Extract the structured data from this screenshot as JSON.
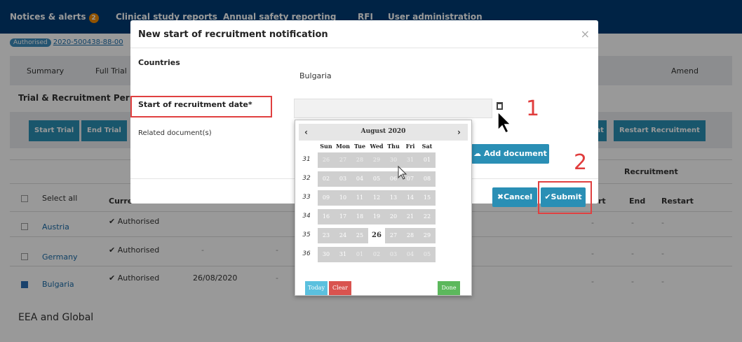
{
  "topnav": {
    "items": [
      "Notices & alerts",
      "Clinical study reports",
      "Annual safety reporting",
      "RFI",
      "User administration"
    ],
    "notice_count": "2"
  },
  "trial": {
    "status_badge": "Authorised",
    "id": "2020-500438-88-00"
  },
  "tabs": [
    "Summary",
    "Full Trial",
    "Amend"
  ],
  "section_title": "Trial & Recruitment Per",
  "actions": {
    "start_trial": "Start Trial",
    "end_trial": "End Trial",
    "restart_recruitment": "Restart Recruitment",
    "partial_left": "nt"
  },
  "table": {
    "select_all": "Select all",
    "current_partial": "Curre",
    "recruitment_header": "Recruitment",
    "col_art": "rt",
    "col_end": "End",
    "col_restart": "Restart",
    "rows": [
      {
        "country": "Austria",
        "status": "Authorised",
        "date": "",
        "checked": false
      },
      {
        "country": "Germany",
        "status": "Authorised",
        "date": "-",
        "checked": false
      },
      {
        "country": "Bulgaria",
        "status": "Authorised",
        "date": "26/08/2020",
        "checked": true
      }
    ],
    "dash": "-"
  },
  "eea_title": "EEA and Global",
  "modal": {
    "title": "New start of recruitment notification",
    "close": "×",
    "countries_label": "Countries",
    "countries_value": "Bulgaria",
    "start_date_label": "Start of recruitment date*",
    "related_docs_label": "Related document(s)",
    "add_document": "Add document",
    "cancel": "Cancel",
    "submit": "Submit"
  },
  "datepicker": {
    "prev": "‹",
    "next": "›",
    "month": "August 2020",
    "days_of_week": [
      "Sun",
      "Mon",
      "Tue",
      "Wed",
      "Thu",
      "Fri",
      "Sat"
    ],
    "weeks": [
      {
        "num": "31",
        "days": [
          [
            "26",
            true
          ],
          [
            "27",
            true
          ],
          [
            "28",
            true
          ],
          [
            "29",
            true
          ],
          [
            "30",
            true
          ],
          [
            "31",
            true
          ],
          [
            "01",
            false
          ]
        ]
      },
      {
        "num": "32",
        "days": [
          [
            "02",
            false
          ],
          [
            "03",
            false
          ],
          [
            "04",
            false
          ],
          [
            "05",
            false
          ],
          [
            "06",
            false
          ],
          [
            "07",
            false
          ],
          [
            "08",
            false
          ]
        ]
      },
      {
        "num": "33",
        "days": [
          [
            "09",
            false
          ],
          [
            "10",
            false
          ],
          [
            "11",
            false
          ],
          [
            "12",
            false
          ],
          [
            "13",
            false
          ],
          [
            "14",
            false
          ],
          [
            "15",
            false
          ]
        ]
      },
      {
        "num": "34",
        "days": [
          [
            "16",
            false
          ],
          [
            "17",
            false
          ],
          [
            "18",
            false
          ],
          [
            "19",
            false
          ],
          [
            "20",
            false
          ],
          [
            "21",
            false
          ],
          [
            "22",
            false
          ]
        ]
      },
      {
        "num": "35",
        "days": [
          [
            "23",
            false
          ],
          [
            "24",
            false
          ],
          [
            "25",
            false
          ],
          [
            "26",
            false
          ],
          [
            "27",
            false
          ],
          [
            "28",
            false
          ],
          [
            "29",
            false
          ]
        ]
      },
      {
        "num": "36",
        "days": [
          [
            "30",
            false
          ],
          [
            "31",
            false
          ],
          [
            "01",
            true
          ],
          [
            "02",
            true
          ],
          [
            "03",
            true
          ],
          [
            "04",
            true
          ],
          [
            "05",
            true
          ]
        ]
      }
    ],
    "selected_day": "26",
    "today_label": "Today",
    "clear_label": "Clear",
    "done_label": "Done"
  },
  "annotations": {
    "step1": "1",
    "step2": "2"
  },
  "colors": {
    "nav": "#003b73",
    "accent": "#2a8fb5",
    "annotation": "#e03c3c",
    "today_btn": "#5bc0de",
    "clear_btn": "#d9534f",
    "done_btn": "#5cb85c"
  }
}
